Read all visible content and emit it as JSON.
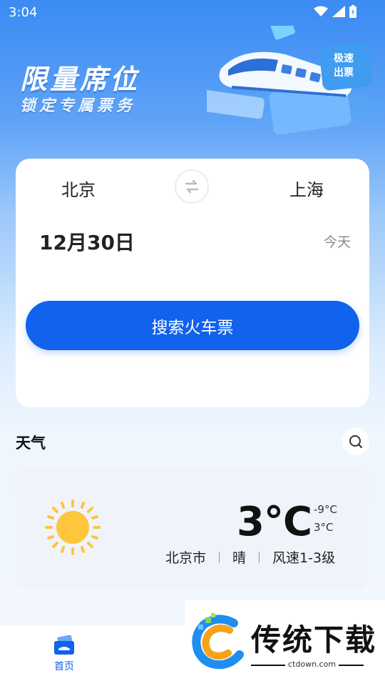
{
  "status_bar": {
    "time": "3:04",
    "icons": [
      "wifi-icon",
      "signal-icon",
      "battery-icon"
    ]
  },
  "banner": {
    "title": "限量席位",
    "subtitle": "锁定专属票务",
    "badge": [
      "极速",
      "出票"
    ]
  },
  "ticket": {
    "from_city": "北京",
    "to_city": "上海",
    "date": "12月30日",
    "day_label": "今天",
    "search_label": "搜索火车票"
  },
  "weather": {
    "section_title": "天气",
    "temperature": "3°C",
    "low": "-9°C",
    "high": "3°C",
    "city": "北京市",
    "condition": "晴",
    "wind": "风速1-3级",
    "icon": "sun-icon"
  },
  "nav": {
    "items": [
      {
        "label": "首页",
        "icon": "ticket-icon",
        "active": true
      },
      {
        "label": "",
        "icon": "nav-icon",
        "active": false
      }
    ]
  },
  "watermark": {
    "text": "传统下载",
    "domain": "ctdown.com"
  },
  "colors": {
    "primary": "#1162ed",
    "sun": "#ffc53d",
    "background_top": "#3b8bf3"
  }
}
